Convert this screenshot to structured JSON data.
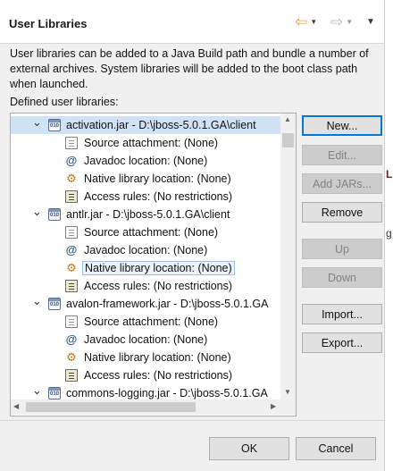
{
  "header": {
    "title": "User Libraries"
  },
  "description": "User libraries can be added to a Java Build path and bundle a number of external archives. System libraries will be added to the boot class path when launched.",
  "defined_label": "Defined user libraries:",
  "libraries": [
    {
      "name": "activation.jar - D:\\jboss-5.0.1.GA\\client",
      "expanded": true,
      "children": [
        {
          "icon": "source-attachment-icon",
          "text": "Source attachment: (None)"
        },
        {
          "icon": "javadoc-location-icon",
          "text": "Javadoc location: (None)"
        },
        {
          "icon": "native-library-icon",
          "text": "Native library location: (None)"
        },
        {
          "icon": "access-rules-icon",
          "text": "Access rules: (No restrictions)"
        }
      ]
    },
    {
      "name": "antlr.jar - D:\\jboss-5.0.1.GA\\client",
      "expanded": true,
      "children": [
        {
          "icon": "source-attachment-icon",
          "text": "Source attachment: (None)"
        },
        {
          "icon": "javadoc-location-icon",
          "text": "Javadoc location: (None)"
        },
        {
          "icon": "native-library-icon",
          "text": "Native library location: (None)"
        },
        {
          "icon": "access-rules-icon",
          "text": "Access rules: (No restrictions)"
        }
      ]
    },
    {
      "name": "avalon-framework.jar - D:\\jboss-5.0.1.GA",
      "expanded": true,
      "children": [
        {
          "icon": "source-attachment-icon",
          "text": "Source attachment: (None)"
        },
        {
          "icon": "javadoc-location-icon",
          "text": "Javadoc location: (None)"
        },
        {
          "icon": "native-library-icon",
          "text": "Native library location: (None)"
        },
        {
          "icon": "access-rules-icon",
          "text": "Access rules: (No restrictions)"
        }
      ]
    },
    {
      "name": "commons-logging.jar - D:\\jboss-5.0.1.GA",
      "expanded": true,
      "children": []
    }
  ],
  "jar_icon_text": "010",
  "buttons": {
    "new": "New...",
    "edit": "Edit...",
    "add_jars": "Add JARs...",
    "remove": "Remove",
    "up": "Up",
    "down": "Down",
    "import": "Import...",
    "export": "Export...",
    "ok": "OK",
    "cancel": "Cancel"
  },
  "right_strip_glyphs": [
    "L",
    "g"
  ],
  "colors": {
    "accent": "#0078d7",
    "selection": "#cfe3f5",
    "back_arrow": "#e8a33c",
    "forward_arrow": "#b9b9b9"
  }
}
